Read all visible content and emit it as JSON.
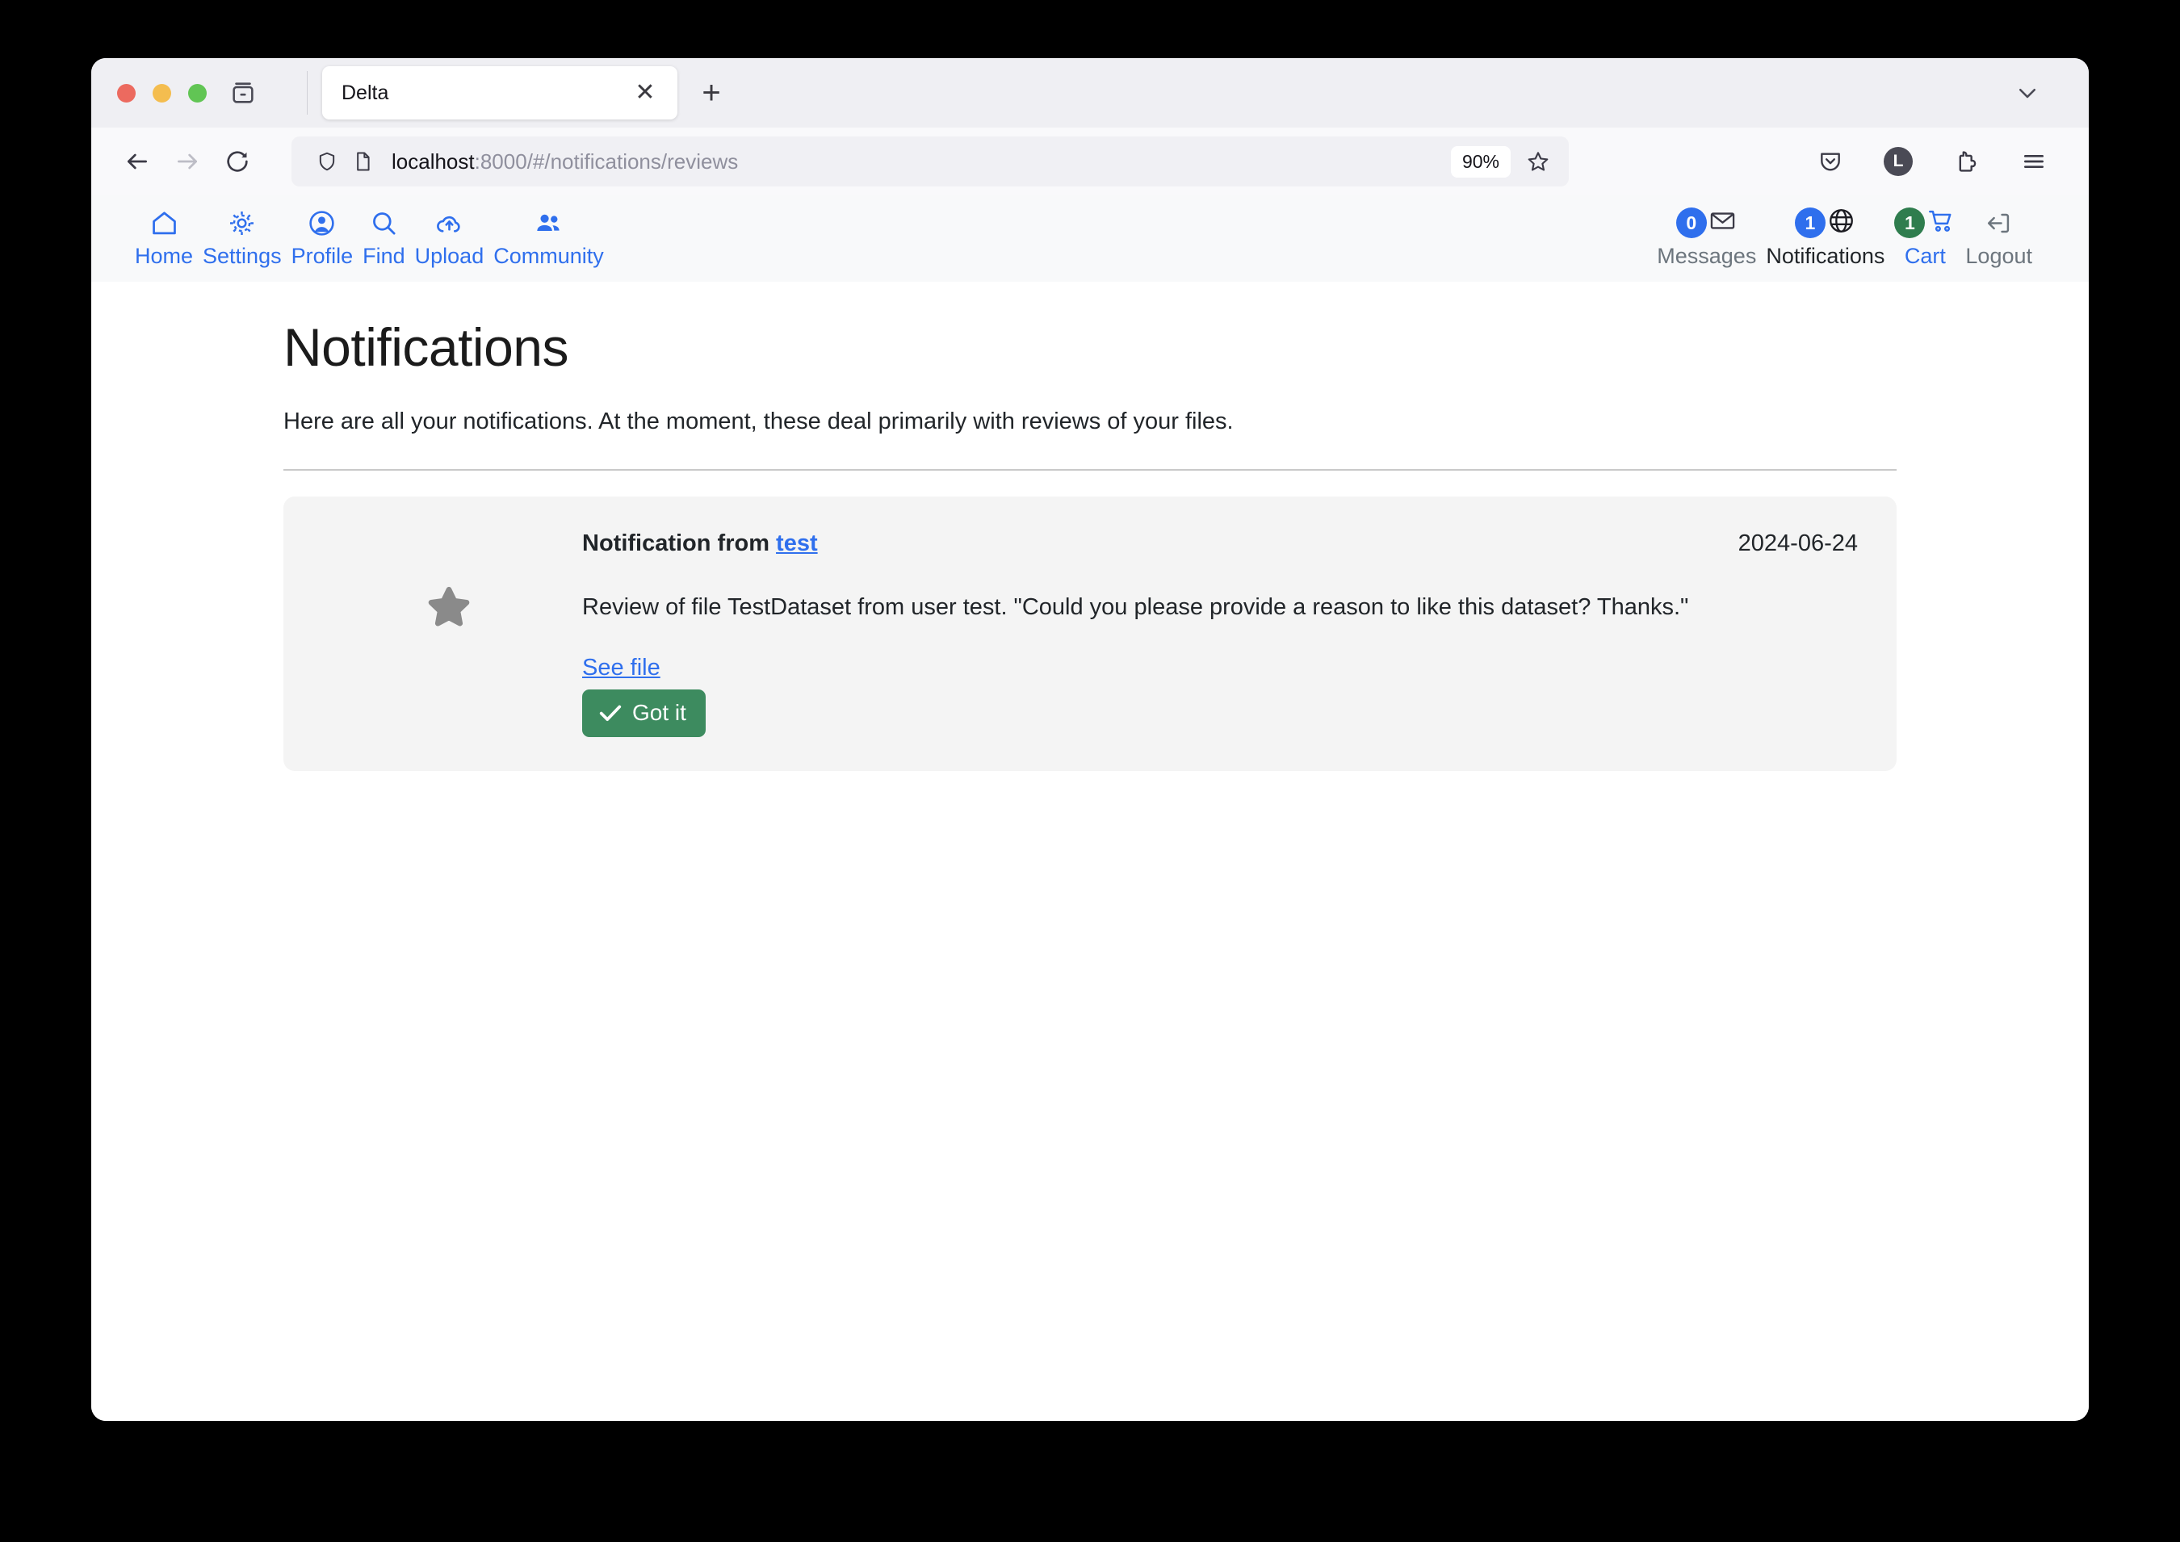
{
  "browser": {
    "tab": {
      "title": "Delta",
      "close_label": "✕"
    },
    "new_tab_label": "+",
    "url": {
      "host": "localhost",
      "rest": ":8000/#/notifications/reviews"
    },
    "zoom_level": "90%",
    "account_initial": "L"
  },
  "app_nav": {
    "left": [
      {
        "label": "Home",
        "icon": "home-icon",
        "style": "link"
      },
      {
        "label": "Settings",
        "icon": "gear-icon",
        "style": "link"
      },
      {
        "label": "Profile",
        "icon": "person-circle-icon",
        "style": "link"
      },
      {
        "label": "Find",
        "icon": "search-icon",
        "style": "link"
      },
      {
        "label": "Upload",
        "icon": "cloud-upload-icon",
        "style": "link"
      },
      {
        "label": "Community",
        "icon": "people-icon",
        "style": "link"
      }
    ],
    "right": [
      {
        "label": "Messages",
        "icon": "envelope-icon",
        "badge": "0",
        "badge_color": "#2f6fed",
        "style": "muted"
      },
      {
        "label": "Notifications",
        "icon": "globe-icon",
        "badge": "1",
        "badge_color": "#2f6fed",
        "style": "dark"
      },
      {
        "label": "Cart",
        "icon": "cart-icon",
        "badge": "1",
        "badge_color": "#2f7d4e",
        "style": "link"
      },
      {
        "label": "Logout",
        "icon": "logout-icon",
        "badge": "",
        "badge_color": "",
        "style": "muted"
      }
    ]
  },
  "page": {
    "title": "Notifications",
    "subtitle": "Here are all your notifications. At the moment, these deal primarily with reviews of your files."
  },
  "notifications": [
    {
      "icon": "star-icon",
      "title_prefix": "Notification from ",
      "from_user": "test",
      "date": "2024-06-24",
      "text": "Review of file TestDataset from user test. \"Could you please provide a reason to like this dataset? Thanks.\"",
      "see_file_label": "See file",
      "got_it_label": "Got it"
    }
  ],
  "colors": {
    "accent_blue": "#2f6fed",
    "success_green": "#3d8b5f",
    "badge_green": "#2f7d4e",
    "card_bg": "#f4f4f4",
    "navbar_bg": "#f8f9fa",
    "muted_text": "#6c757d"
  }
}
